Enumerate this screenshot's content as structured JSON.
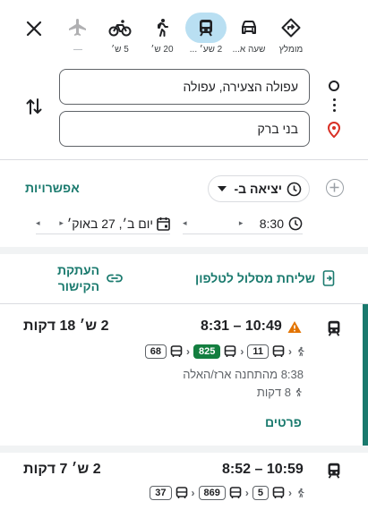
{
  "modes": [
    {
      "key": "best",
      "label": "מומלץ",
      "icon": "route-diamond-icon"
    },
    {
      "key": "car",
      "label": "שעה א...",
      "icon": "car-icon"
    },
    {
      "key": "transit",
      "label": "2 שע׳ ...",
      "icon": "train-icon",
      "active": true
    },
    {
      "key": "walk",
      "label": "20 ש׳",
      "icon": "walking-icon"
    },
    {
      "key": "bike",
      "label": "5 ש׳",
      "icon": "bicycle-icon"
    },
    {
      "key": "flight",
      "label": "—",
      "icon": "airplane-icon"
    }
  ],
  "origin": "עפולה הצעירה, עפולה",
  "destination": "בני ברק",
  "depart_label": "יציאה ב-",
  "options_label": "אפשרויות",
  "date_value": "יום ב׳, 27 באוק׳",
  "time_value": "8:30",
  "send_label": "שליחת מסלול לטלפון",
  "copy_link_label_1": "העתקת",
  "copy_link_label_2": "הקישור",
  "routes": [
    {
      "times": "8:31 – 10:49",
      "duration": "2 ש׳ 18 דקות",
      "chips": [
        "11",
        "825",
        "68"
      ],
      "stop_line": "8:38 מהתחנה ארז/האלה",
      "walk_line": "8 דקות",
      "details_label": "פרטים",
      "warning": true
    },
    {
      "times": "8:52 – 10:59",
      "duration": "2 ש׳ 7 דקות",
      "chips": [
        "5",
        "869",
        "37"
      ]
    }
  ],
  "colors": {
    "accent": "#1a7a6e",
    "active_pill": "#b9dff2",
    "green_chip": "#137e3f",
    "warning": "#e37400",
    "pin": "#d93025"
  }
}
